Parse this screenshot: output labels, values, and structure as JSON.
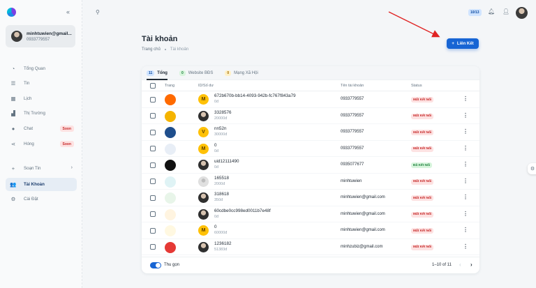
{
  "sidebar": {
    "account": {
      "email": "minhtuwien@gmail...",
      "phone": "0933779557"
    },
    "items": [
      {
        "label": "Tổng Quan",
        "icon": "dashboard-icon",
        "glyph": "◔"
      },
      {
        "label": "Tin",
        "icon": "list-icon",
        "glyph": "☰"
      },
      {
        "label": "Lịch",
        "icon": "calendar-icon",
        "glyph": "▦"
      },
      {
        "label": "Thị Trường",
        "icon": "chart-icon",
        "glyph": "▟"
      },
      {
        "label": "Chat",
        "icon": "chat-icon",
        "glyph": "●",
        "badge": "Soon"
      },
      {
        "label": "Hóng",
        "icon": "share-icon",
        "glyph": "⋖",
        "badge": "Soon"
      },
      {
        "label": "Soạn Tin",
        "icon": "plus-icon",
        "glyph": "+"
      },
      {
        "label": "Tài Khoản",
        "icon": "users-icon",
        "glyph": "👥",
        "active": true
      },
      {
        "label": "Cài Đặt",
        "icon": "gear-icon",
        "glyph": "⚙"
      }
    ]
  },
  "topbar": {
    "badge": "10/13"
  },
  "page": {
    "title": "Tài khoản",
    "breadcrumb": {
      "home": "Trang chủ",
      "current": "Tài khoản"
    },
    "link_button": "Liên Kết"
  },
  "tabs": [
    {
      "count": "11",
      "label": "Tổng",
      "color": "blue",
      "active": true
    },
    {
      "count": "0",
      "label": "Website BĐS",
      "color": "green"
    },
    {
      "count": "0",
      "label": "Mạng Xã Hội",
      "color": "yellow"
    }
  ],
  "table": {
    "headers": {
      "trang": "Trang",
      "id": "ID/Số dư",
      "ten": "Tên tài khoản",
      "status": "Status"
    },
    "rows": [
      {
        "logo_color": "#ff6a00",
        "avatar": "letter",
        "letter": "M",
        "id": "672b670b-bb14-4093-942b-fc767f843a79",
        "balance": "0đ",
        "ten": "0933779557",
        "status": "Mất Kết Nối",
        "status_type": "bad"
      },
      {
        "logo_color": "#f5b400",
        "avatar": "photo",
        "letter": "",
        "id": "3328576",
        "balance": "20000đ",
        "ten": "0933779557",
        "status": "Mất Kết Nối",
        "status_type": "bad"
      },
      {
        "logo_color": "#1f4e8c",
        "avatar": "letter",
        "letter": "V",
        "id": "nn52n",
        "balance": "30000đ",
        "ten": "0933779557",
        "status": "Mất Kết Nối",
        "status_type": "bad"
      },
      {
        "logo_color": "#e8eef6",
        "avatar": "letter",
        "letter": "M",
        "id": "0",
        "balance": "0đ",
        "ten": "0933779557",
        "status": "Mất Kết Nối",
        "status_type": "bad"
      },
      {
        "logo_color": "#111111",
        "avatar": "photo",
        "letter": "",
        "id": "uid12111490",
        "balance": "0đ",
        "ten": "0935077677",
        "status": "Đã Kết Nối",
        "status_type": "ok"
      },
      {
        "logo_color": "#dff3f5",
        "avatar": "grey",
        "letter": "",
        "id": "165518",
        "balance": "2000đ",
        "ten": "minhtuwien",
        "status": "Mất Kết Nối",
        "status_type": "bad"
      },
      {
        "logo_color": "#e8f5e9",
        "avatar": "photo",
        "letter": "",
        "id": "318618",
        "balance": "350đ",
        "ten": "minhtuwien@gmail.com",
        "status": "Mất Kết Nối",
        "status_type": "bad"
      },
      {
        "logo_color": "#fff4e0",
        "avatar": "photo",
        "letter": "",
        "id": "60cdbe0cc998ed0011b7e48f",
        "balance": "0đ",
        "ten": "minhtuwien@gmail.com",
        "status": "Mất Kết Nối",
        "status_type": "bad"
      },
      {
        "logo_color": "#fff8e1",
        "avatar": "letter",
        "letter": "M",
        "id": "0",
        "balance": "60000đ",
        "ten": "minhtuwien@gmail.com",
        "status": "Mất Kết Nối",
        "status_type": "bad"
      },
      {
        "logo_color": "#e53935",
        "avatar": "photo",
        "letter": "",
        "id": "1236182",
        "balance": "51383đ",
        "ten": "minhzubiz@gmail.com",
        "status": "Mất Kết Nối",
        "status_type": "bad"
      }
    ]
  },
  "footer": {
    "toggle_label": "Thu gọn",
    "pagination": "1–10 of 11"
  },
  "colors": {
    "primary": "#1765d4",
    "danger": "#c62828",
    "success": "#1b7f3a",
    "annotation_arrow": "#e02424"
  }
}
